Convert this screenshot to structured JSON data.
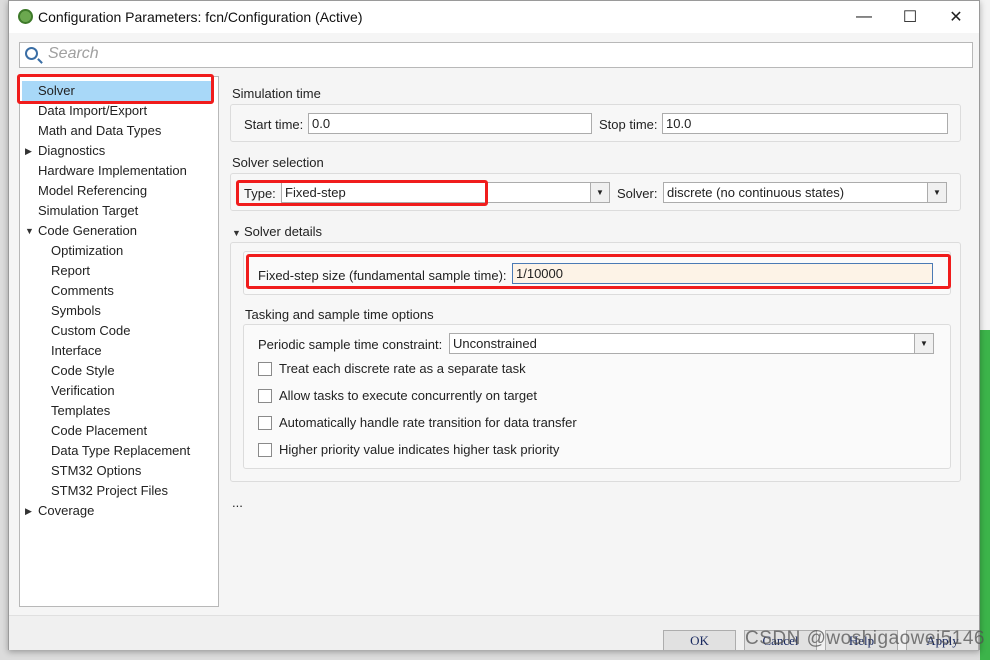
{
  "window": {
    "title": "Configuration Parameters: fcn/Configuration (Active)",
    "minimize": "—",
    "maximize": "☐",
    "close": "✕"
  },
  "search": {
    "placeholder": "Search"
  },
  "tree": [
    {
      "label": "Solver",
      "level": 0,
      "selected": true
    },
    {
      "label": "Data Import/Export",
      "level": 0
    },
    {
      "label": "Math and Data Types",
      "level": 0
    },
    {
      "label": "Diagnostics",
      "level": 0,
      "arrow": "▶"
    },
    {
      "label": "Hardware Implementation",
      "level": 0
    },
    {
      "label": "Model Referencing",
      "level": 0
    },
    {
      "label": "Simulation Target",
      "level": 0
    },
    {
      "label": "Code Generation",
      "level": 0,
      "arrow": "▼"
    },
    {
      "label": "Optimization",
      "level": 1
    },
    {
      "label": "Report",
      "level": 1
    },
    {
      "label": "Comments",
      "level": 1
    },
    {
      "label": "Symbols",
      "level": 1
    },
    {
      "label": "Custom Code",
      "level": 1
    },
    {
      "label": "Interface",
      "level": 1
    },
    {
      "label": "Code Style",
      "level": 1
    },
    {
      "label": "Verification",
      "level": 1
    },
    {
      "label": "Templates",
      "level": 1
    },
    {
      "label": "Code Placement",
      "level": 1
    },
    {
      "label": "Data Type Replacement",
      "level": 1
    },
    {
      "label": "STM32 Options",
      "level": 1
    },
    {
      "label": "STM32 Project Files",
      "level": 1
    },
    {
      "label": "Coverage",
      "level": 0,
      "arrow": "▶"
    }
  ],
  "sim_time": {
    "heading": "Simulation time",
    "start_label": "Start time:",
    "start_value": "0.0",
    "stop_label": "Stop time:",
    "stop_value": "10.0"
  },
  "solver_sel": {
    "heading": "Solver selection",
    "type_label": "Type:",
    "type_value": "Fixed-step",
    "solver_label": "Solver:",
    "solver_value": "discrete (no continuous states)"
  },
  "details": {
    "heading": "Solver details",
    "step_label": "Fixed-step size (fundamental sample time):",
    "step_value": "1/10000"
  },
  "tasking": {
    "heading": "Tasking and sample time options",
    "constraint_label": "Periodic sample time constraint:",
    "constraint_value": "Unconstrained",
    "checkboxes": [
      "Treat each discrete rate as a separate task",
      "Allow tasks to execute concurrently on target",
      "Automatically handle rate transition for data transfer",
      "Higher priority value indicates higher task priority"
    ]
  },
  "ellipsis": "...",
  "buttons": {
    "ok": "OK",
    "cancel": "Cancel",
    "help": "Help",
    "apply": "Apply"
  },
  "watermark": "CSDN @woshigaowei5146",
  "colors": {
    "selection": "#a8d8f8",
    "highlight": "#f01c1c",
    "step_field": "#fdf3e7"
  }
}
